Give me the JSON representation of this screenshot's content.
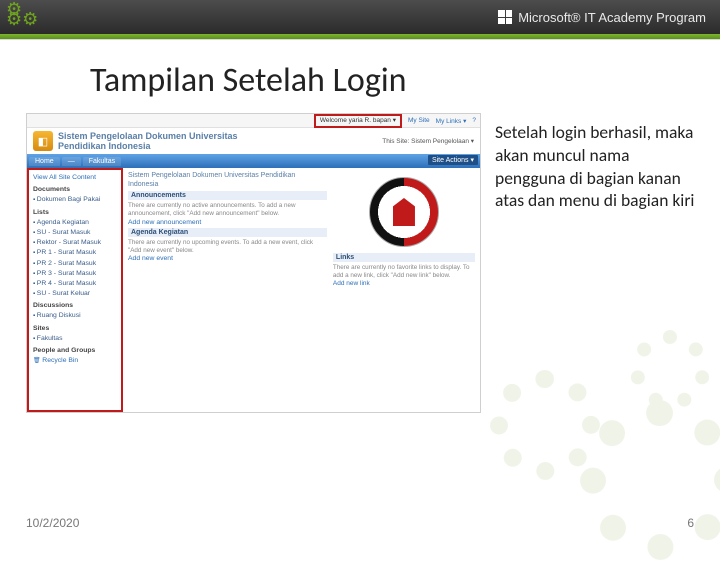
{
  "header": {
    "program": "Microsoft® IT Academy Program"
  },
  "slide": {
    "title": "Tampilan Setelah Login",
    "description": "Setelah login berhasil, maka akan muncul nama pengguna di bagian kanan atas dan menu di bagian kiri",
    "date": "10/2/2020",
    "page_number": "6"
  },
  "screenshot": {
    "topbar": {
      "welcome": "Welcome yaria R. bapan ▾",
      "mysite": "My Site",
      "mylinks": "My Links ▾",
      "help": "?"
    },
    "site": {
      "name": "Sistem Pengelolaan Dokumen Universitas Pendidikan Indonesia",
      "search_label": "This Site: Sistem Pengelolaan ▾"
    },
    "tabs": {
      "home": "Home",
      "t2": "—",
      "t3": "Fakultas",
      "site_actions": "Site Actions ▾"
    },
    "leftnav": {
      "view_all": "View All Site Content",
      "documents_hdr": "Documents",
      "documents": [
        "Dokumen Bagi Pakai"
      ],
      "lists_hdr": "Lists",
      "lists": [
        "Agenda Kegiatan",
        "SU - Surat Masuk",
        "Rektor - Surat Masuk",
        "PR 1 - Surat Masuk",
        "PR 2 - Surat Masuk",
        "PR 3 - Surat Masuk",
        "PR 4 - Surat Masuk",
        "SU - Surat Keluar"
      ],
      "discussions_hdr": "Discussions",
      "discussions": [
        "Ruang Diskusi"
      ],
      "sites_hdr": "Sites",
      "sites": [
        "Fakultas"
      ],
      "people_hdr": "People and Groups",
      "recycle": "Recycle Bin"
    },
    "center": {
      "page_heading": "Sistem Pengelolaan Dokumen Universitas Pendidikan Indonesia",
      "announcements_hdr": "Announcements",
      "announcements_text": "There are currently no active announcements. To add a new announcement, click \"Add new announcement\" below.",
      "add_announcement": "Add new announcement",
      "agenda_hdr": "Agenda Kegiatan",
      "agenda_text": "There are currently no upcoming events. To add a new event, click \"Add new event\" below.",
      "add_event": "Add new event"
    },
    "right": {
      "links_hdr": "Links",
      "links_text": "There are currently no favorite links to display. To add a new link, click \"Add new link\" below.",
      "add_link": "Add new link"
    }
  }
}
